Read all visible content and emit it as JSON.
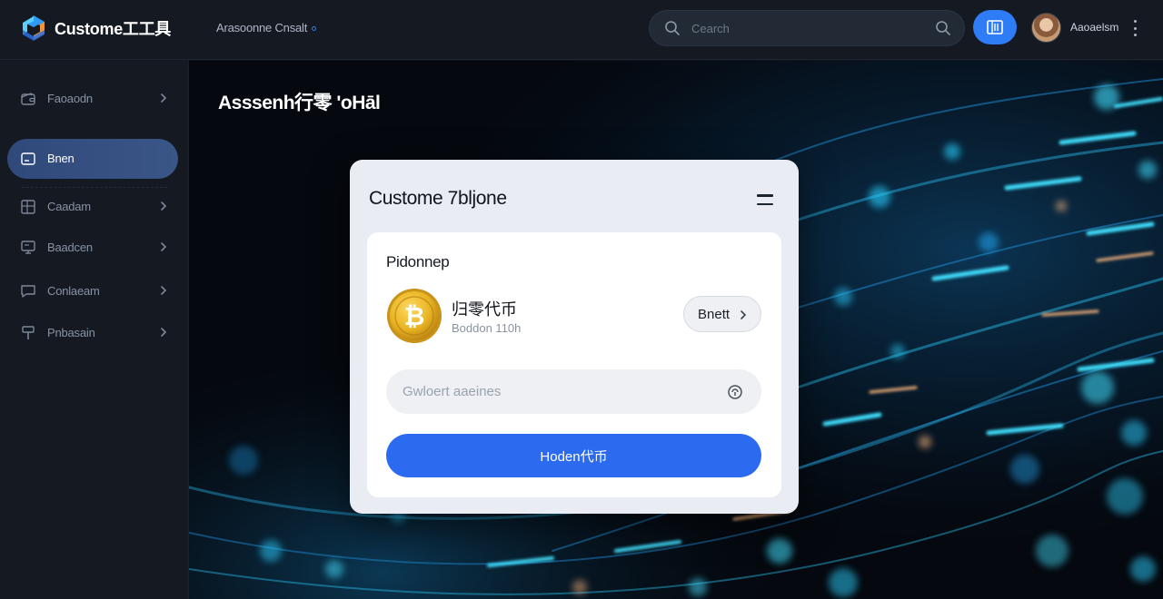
{
  "app": {
    "brand_name": "Custome工工具",
    "breadcrumb": "Arasoonne Cnsalt"
  },
  "search": {
    "placeholder": "Cearch"
  },
  "user": {
    "name": "Aaoaelsm"
  },
  "sidebar": {
    "items": [
      {
        "label": "Faoaodn",
        "icon": "wallet-icon",
        "has_chevron": true,
        "active": false
      },
      {
        "label": "Bnen",
        "icon": "card-icon",
        "has_chevron": false,
        "active": true
      },
      {
        "label": "Caadam",
        "icon": "grid-icon",
        "has_chevron": true,
        "active": false
      },
      {
        "label": "Baadcen",
        "icon": "monitor-icon",
        "has_chevron": true,
        "active": false
      },
      {
        "label": "Conlaeam",
        "icon": "message-icon",
        "has_chevron": true,
        "active": false
      },
      {
        "label": "Pnbasain",
        "icon": "tool-icon",
        "has_chevron": true,
        "active": false
      }
    ]
  },
  "main": {
    "page_title": "Asssenh行零 'oHāl"
  },
  "dialog": {
    "title": "Custome 7bljone",
    "card": {
      "label": "Pidonnep",
      "coin_name": "归零代币",
      "coin_sub": "Boddon 110h",
      "coin_symbol": "₿",
      "select_label": "Bnett",
      "amount_placeholder": "Gwloert aaeines",
      "submit_label": "Hoden代币"
    }
  },
  "colors": {
    "accent": "#2f7df6",
    "primary_button": "#2c6bf0",
    "sidebar_active": "#34507f",
    "coin_gold": "#e8b423"
  }
}
